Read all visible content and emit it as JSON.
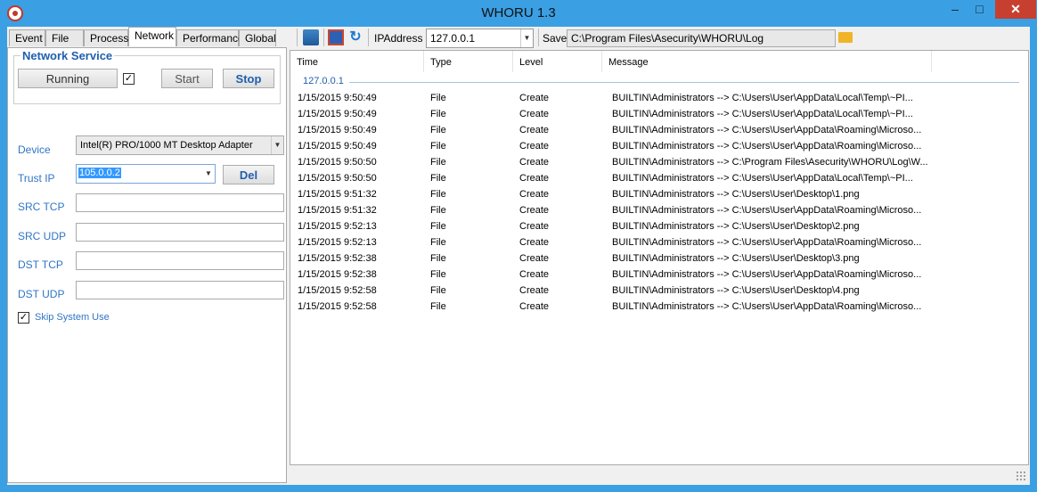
{
  "window": {
    "title": "WHORU 1.3",
    "minimize": "–",
    "maximize": "□",
    "close": "✕"
  },
  "tabs": [
    "Event",
    "File",
    "Process",
    "Network",
    "Performance",
    "Global"
  ],
  "active_tab": "Network",
  "toolbar": {
    "ip_label": "IPAddress",
    "ip_value": "127.0.0.1",
    "save_label": "Save",
    "save_path": "C:\\Program Files\\Asecurity\\WHORU\\Log",
    "icons": [
      "book-icon",
      "save-icon",
      "refresh-icon",
      "folder-icon"
    ]
  },
  "network_service": {
    "title": "Network Service",
    "status": "Running",
    "status_checked": true,
    "start_label": "Start",
    "stop_label": "Stop"
  },
  "form": {
    "device_label": "Device",
    "device_value": "Intel(R) PRO/1000 MT Desktop Adapter",
    "trust_ip_label": "Trust IP",
    "trust_ip_value": "105.0.0.2",
    "del_label": "Del",
    "src_tcp_label": "SRC TCP",
    "src_udp_label": "SRC UDP",
    "dst_tcp_label": "DST TCP",
    "dst_udp_label": "DST UDP",
    "skip_label": "Skip System Use",
    "skip_checked": true
  },
  "log": {
    "columns": [
      "Time",
      "Type",
      "Level",
      "Message"
    ],
    "group": "127.0.0.1",
    "rows": [
      [
        "1/15/2015 9:50:49",
        "File",
        "Create",
        "BUILTIN\\Administrators --> C:\\Users\\User\\AppData\\Local\\Temp\\~PI..."
      ],
      [
        "1/15/2015 9:50:49",
        "File",
        "Create",
        "BUILTIN\\Administrators --> C:\\Users\\User\\AppData\\Local\\Temp\\~PI..."
      ],
      [
        "1/15/2015 9:50:49",
        "File",
        "Create",
        "BUILTIN\\Administrators --> C:\\Users\\User\\AppData\\Roaming\\Microso..."
      ],
      [
        "1/15/2015 9:50:49",
        "File",
        "Create",
        "BUILTIN\\Administrators --> C:\\Users\\User\\AppData\\Roaming\\Microso..."
      ],
      [
        "1/15/2015 9:50:50",
        "File",
        "Create",
        "BUILTIN\\Administrators --> C:\\Program Files\\Asecurity\\WHORU\\Log\\W..."
      ],
      [
        "1/15/2015 9:50:50",
        "File",
        "Create",
        "BUILTIN\\Administrators --> C:\\Users\\User\\AppData\\Local\\Temp\\~PI..."
      ],
      [
        "1/15/2015 9:51:32",
        "File",
        "Create",
        "BUILTIN\\Administrators --> C:\\Users\\User\\Desktop\\1.png"
      ],
      [
        "1/15/2015 9:51:32",
        "File",
        "Create",
        "BUILTIN\\Administrators --> C:\\Users\\User\\AppData\\Roaming\\Microso..."
      ],
      [
        "1/15/2015 9:52:13",
        "File",
        "Create",
        "BUILTIN\\Administrators --> C:\\Users\\User\\Desktop\\2.png"
      ],
      [
        "1/15/2015 9:52:13",
        "File",
        "Create",
        "BUILTIN\\Administrators --> C:\\Users\\User\\AppData\\Roaming\\Microso..."
      ],
      [
        "1/15/2015 9:52:38",
        "File",
        "Create",
        "BUILTIN\\Administrators --> C:\\Users\\User\\Desktop\\3.png"
      ],
      [
        "1/15/2015 9:52:38",
        "File",
        "Create",
        "BUILTIN\\Administrators --> C:\\Users\\User\\AppData\\Roaming\\Microso..."
      ],
      [
        "1/15/2015 9:52:58",
        "File",
        "Create",
        "BUILTIN\\Administrators --> C:\\Users\\User\\Desktop\\4.png"
      ],
      [
        "1/15/2015 9:52:58",
        "File",
        "Create",
        "BUILTIN\\Administrators --> C:\\Users\\User\\AppData\\Roaming\\Microso..."
      ]
    ]
  },
  "colors": {
    "titlebar": "#3b9fe3",
    "accent": "#1f5fae",
    "label_blue": "#2f75c6",
    "close": "#c7402f"
  }
}
